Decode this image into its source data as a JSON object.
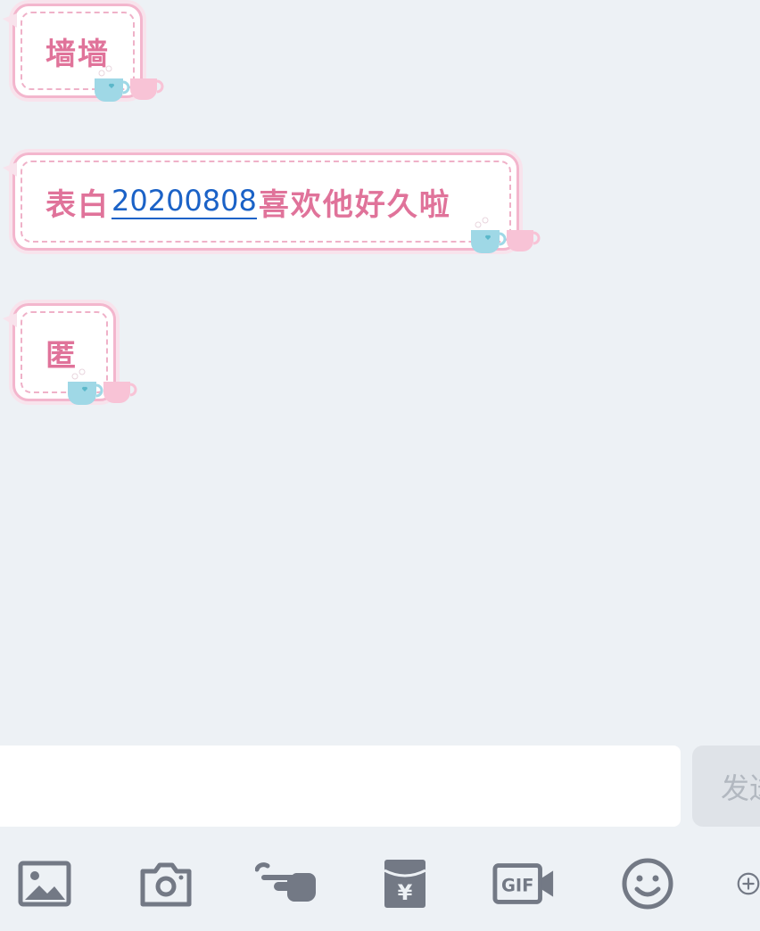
{
  "messages": [
    {
      "text": "墙墙"
    },
    {
      "text_before": "表白",
      "link": "20200808",
      "text_after": "喜欢他好久啦"
    },
    {
      "text": "匿"
    }
  ],
  "composer": {
    "input_value": "",
    "send_label": "发送"
  },
  "toolbar": {
    "icons": [
      "image-icon",
      "camera-icon",
      "poke-icon",
      "red-packet-icon",
      "gif-icon",
      "emoji-icon",
      "more-icon"
    ]
  },
  "colors": {
    "background": "#edf1f5",
    "bubble_border": "#f3b6cd",
    "bubble_text": "#e0739a",
    "link": "#1b62c7",
    "icon": "#737985"
  }
}
